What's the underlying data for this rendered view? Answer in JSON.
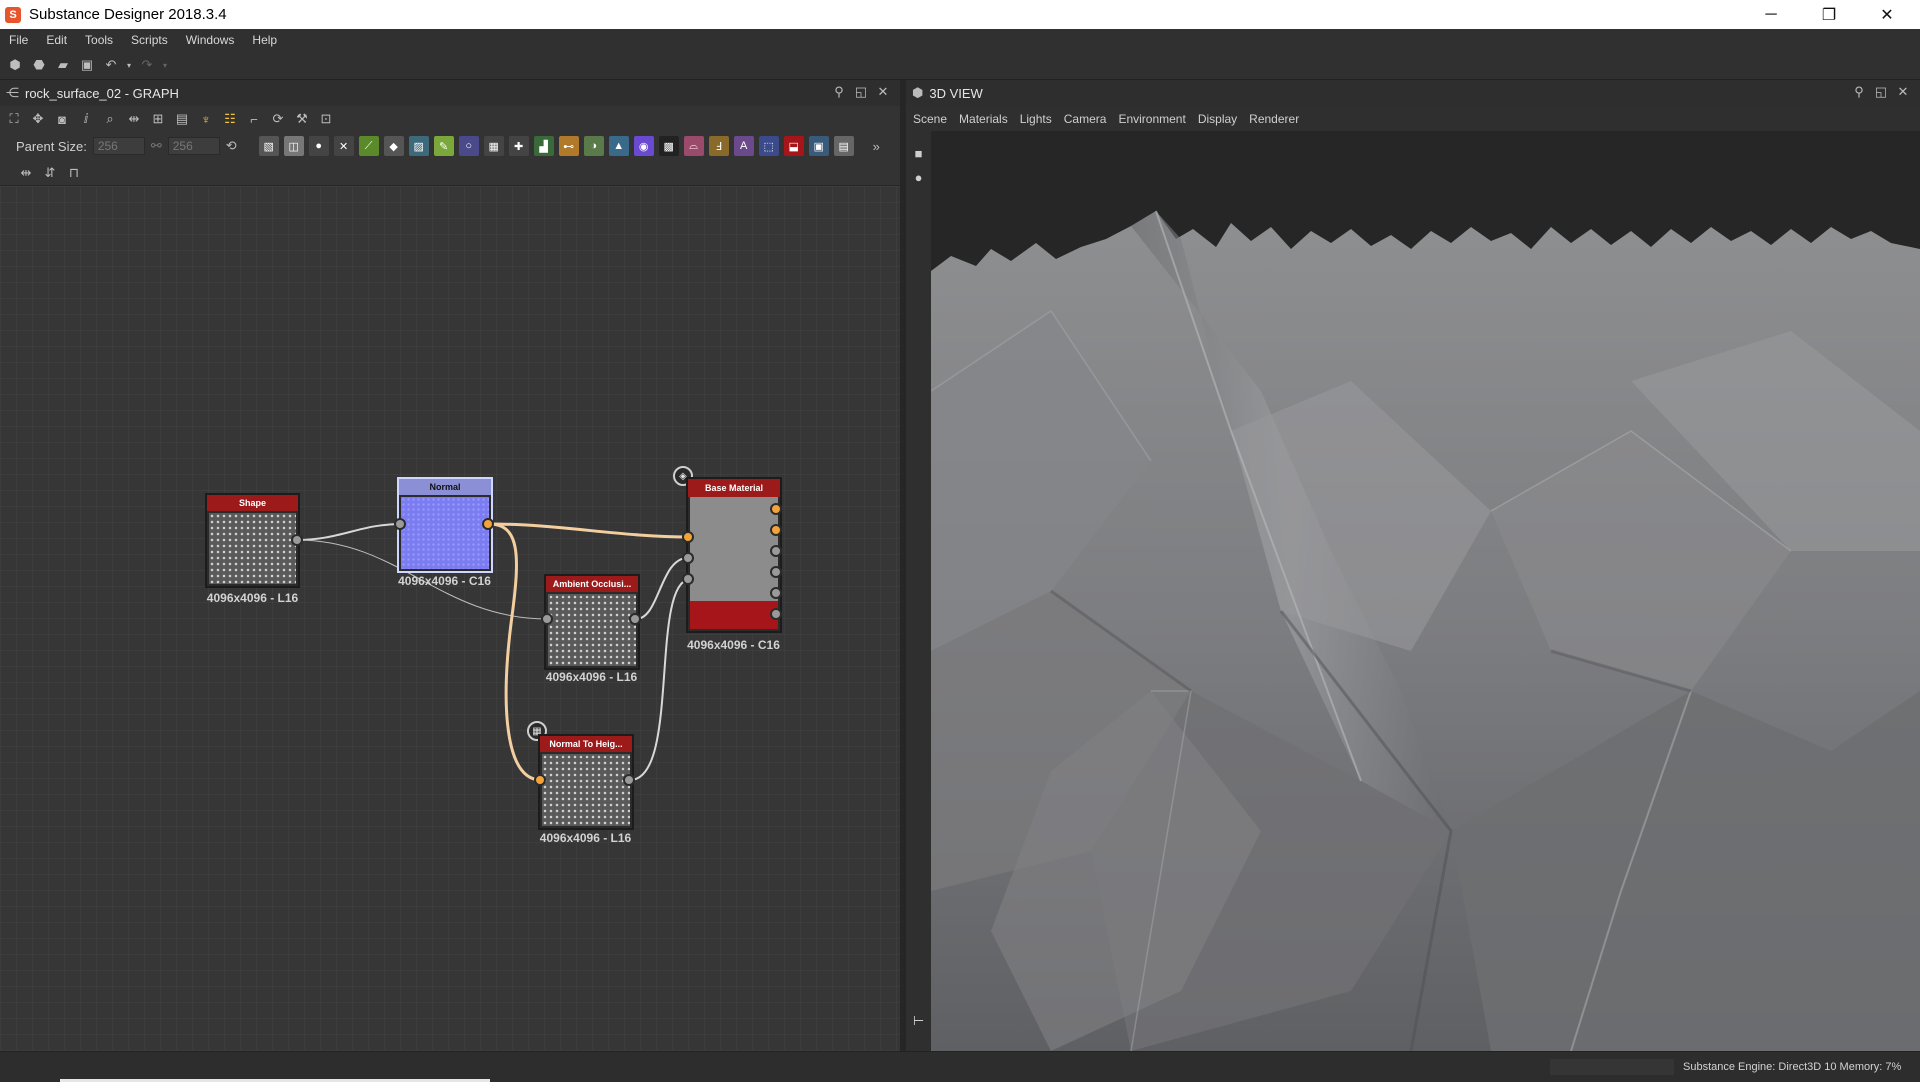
{
  "window": {
    "title": "Substance Designer 2018.3.4",
    "app_icon": "substance-designer-icon",
    "controls": {
      "minimize": "─",
      "maximize": "❐",
      "close": "✕"
    }
  },
  "menu": [
    "File",
    "Edit",
    "Tools",
    "Scripts",
    "Windows",
    "Help"
  ],
  "graph_panel": {
    "title": "rock_surface_02 - GRAPH",
    "parent_size_label": "Parent Size:",
    "parent_size_w": "256",
    "parent_size_h": "256"
  },
  "nodes": {
    "shape": {
      "name": "Shape",
      "label": "4096x4096 - L16"
    },
    "normal": {
      "name": "Normal",
      "label": "4096x4096 - C16"
    },
    "ambient_occlusion": {
      "name": "Ambient Occlusi...",
      "label": "4096x4096 - L16"
    },
    "normal_to_height": {
      "name": "Normal To Heig...",
      "label": "4096x4096 - L16"
    },
    "base_material": {
      "name": "Base Material",
      "label": "4096x4096 - C16"
    }
  },
  "view_panel": {
    "title": "3D VIEW",
    "menu": [
      "Scene",
      "Materials",
      "Lights",
      "Camera",
      "Environment",
      "Display",
      "Renderer"
    ]
  },
  "statusbar": {
    "engine_text": "Substance Engine: Direct3D 10  Memory: 7%"
  },
  "colors": {
    "accent_orange": "#f2a33a",
    "node_header_red": "#9c1a1a",
    "normal_blue": "#7b7cf0"
  }
}
